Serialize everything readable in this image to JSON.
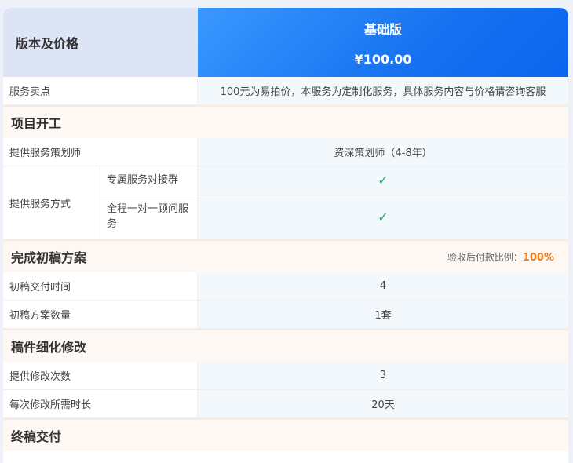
{
  "header": {
    "left_title": "版本及价格",
    "plan_name": "基础版",
    "plan_price": "¥100.00"
  },
  "service_point": {
    "label": "服务卖点",
    "value": "100元为易拍价，本服务为定制化服务，具体服务内容与价格请咨询客服"
  },
  "sections": {
    "kickoff": {
      "title": "项目开工",
      "planner_label": "提供服务策划师",
      "planner_value": "资深策划师（4-8年）",
      "method_label": "提供服务方式",
      "methods": [
        {
          "label": "专属服务对接群",
          "value": "✓"
        },
        {
          "label": "全程一对一顾问服务",
          "value": "✓"
        }
      ]
    },
    "draft": {
      "title": "完成初稿方案",
      "ratio_label": "验收后付款比例：",
      "ratio_value": "100%",
      "rows": [
        {
          "label": "初稿交付时间",
          "value": "4"
        },
        {
          "label": "初稿方案数量",
          "value": "1套"
        }
      ]
    },
    "revise": {
      "title": "稿件细化修改",
      "rows": [
        {
          "label": "提供修改次数",
          "value": "3"
        },
        {
          "label": "每次修改所需时长",
          "value": "20天"
        }
      ]
    },
    "final": {
      "title": "终稿交付"
    }
  },
  "colors": {
    "header_blue": "#1672f0",
    "check_green": "#21a675",
    "ratio_orange": "#f07a1a"
  }
}
